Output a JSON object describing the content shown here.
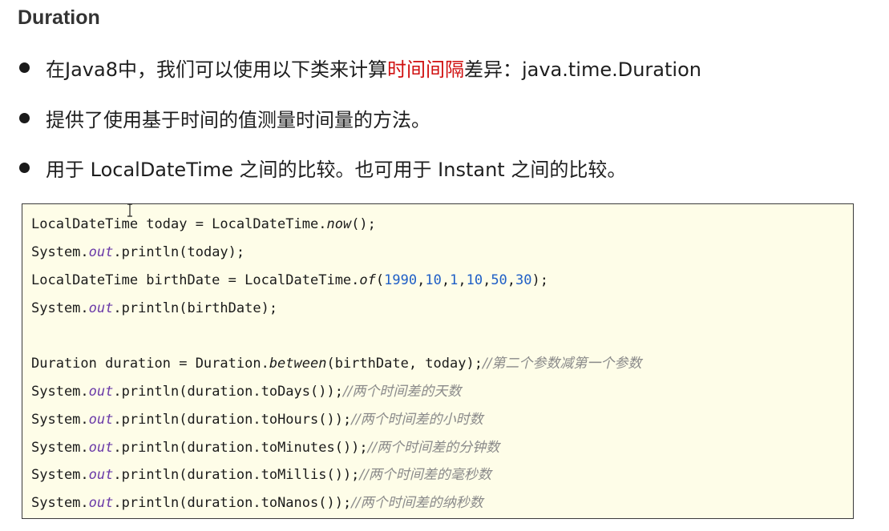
{
  "title": "Duration",
  "bullets": [
    {
      "pre": "在Java8中，我们可以使用以下类来计算",
      "highlight": "时间间隔",
      "post": "差异：java.time.Duration"
    },
    {
      "text": "提供了使用基于时间的值测量时间量的方法。"
    },
    {
      "text": "用于 LocalDateTime 之间的比较。也可用于 Instant 之间的比较。"
    }
  ],
  "colors": {
    "highlight": "#d01010",
    "code_background": "#fefde8",
    "static_field": "#6a3aa8",
    "number": "#1f5fc6",
    "comment": "#8a8a8a"
  },
  "code": {
    "l1": {
      "a": "LocalDateTime today = LocalDateTime.",
      "m": "now",
      "b": "();"
    },
    "l2": {
      "a": "System.",
      "f": "out",
      "b": ".println(today);"
    },
    "l3": {
      "a": "LocalDateTime birthDate = LocalDateTime.",
      "m": "of",
      "p": "(",
      "n1": "1990",
      "n2": "10",
      "n3": "1",
      "n4": "10",
      "n5": "50",
      "n6": "30",
      "sep": ",",
      "b": ");"
    },
    "l4": {
      "a": "System.",
      "f": "out",
      "b": ".println(birthDate);"
    },
    "l5": {
      "a": "Duration duration = Duration.",
      "m": "between",
      "b": "(birthDate, today);",
      "c": "//第二个参数减第一个参数"
    },
    "l6": {
      "a": "System.",
      "f": "out",
      "b": ".println(duration.toDays());",
      "c": "//两个时间差的天数"
    },
    "l7": {
      "a": "System.",
      "f": "out",
      "b": ".println(duration.toHours());",
      "c": "//两个时间差的小时数"
    },
    "l8": {
      "a": "System.",
      "f": "out",
      "b": ".println(duration.toMinutes());",
      "c": "//两个时间差的分钟数"
    },
    "l9": {
      "a": "System.",
      "f": "out",
      "b": ".println(duration.toMillis());",
      "c": "//两个时间差的毫秒数"
    },
    "l10": {
      "a": "System.",
      "f": "out",
      "b": ".println(duration.toNanos());",
      "c": "//两个时间差的纳秒数"
    }
  },
  "icons": {
    "cursor": "text-cursor-icon"
  }
}
